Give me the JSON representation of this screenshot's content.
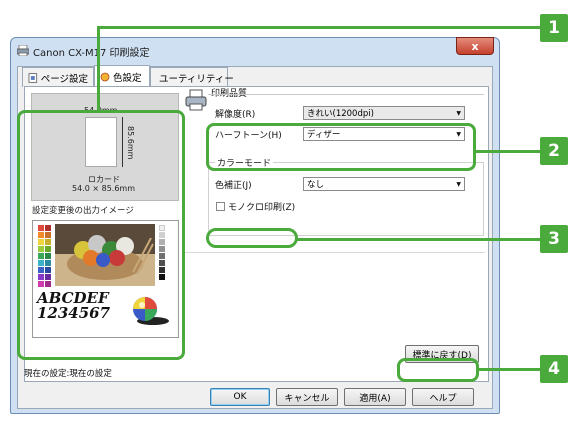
{
  "window": {
    "title": "Canon CX-M17 印刷設定",
    "close_glyph": "x"
  },
  "tabs": [
    {
      "label": "ページ設定",
      "icon": "page-setup-icon"
    },
    {
      "label": "色設定",
      "icon": "color-settings-icon"
    },
    {
      "label": "ユーティリティー",
      "icon": "utility-icon"
    }
  ],
  "preview": {
    "width_label": "54.0mm",
    "height_label": "85.6mm",
    "paper_name": "ロカード",
    "paper_size": "54.0 × 85.6mm",
    "output_image_label": "設定変更後の出力イメージ",
    "sample_text_1": "ABCDEF",
    "sample_text_2": "1234567"
  },
  "print_quality": {
    "group_label": "印刷品質",
    "resolution_label": "解像度(R)",
    "resolution_value": "きれい(1200dpi)",
    "halftone_label": "ハーフトーン(H)",
    "halftone_value": "ディザー"
  },
  "color_mode": {
    "group_label": "カラーモード",
    "correction_label": "色補正(J)",
    "correction_value": "なし",
    "mono_label": "モノクロ印刷(Z)"
  },
  "restore_button": "標準に戻す(D)",
  "current_setting": "現在の設定:現在の設定",
  "buttons": {
    "ok": "OK",
    "cancel": "キャンセル",
    "apply": "適用(A)",
    "help": "ヘルプ"
  },
  "callouts": [
    "1",
    "2",
    "3",
    "4"
  ],
  "colors": {
    "callout_green": "#4aaa3c",
    "window_frame": "#cfe0f3",
    "close_red": "#c4412d"
  }
}
